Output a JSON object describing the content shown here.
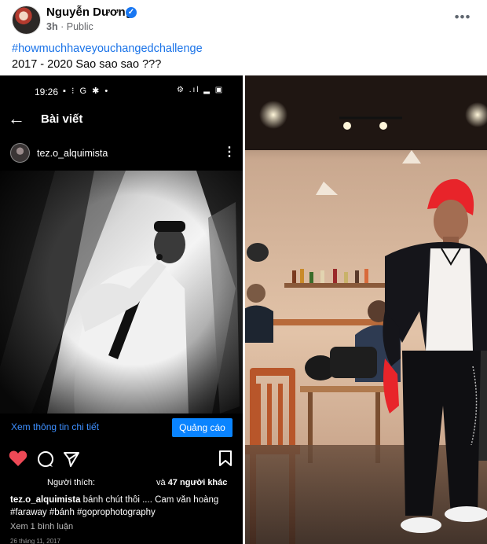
{
  "post": {
    "author": "Nguyễn Dương",
    "time": "3h",
    "separator": "·",
    "audience": "Public",
    "more_glyph": "•••",
    "hashtag": "#howmuchhaveyouchangedchallenge",
    "caption": "2017 - 2020 Sao sao sao ???"
  },
  "icons": {
    "verified": "verified-badge-icon",
    "more": "more-options-icon"
  },
  "instagram": {
    "status_time": "19:26",
    "status_icons": "▪ ⁝ G ✱ •",
    "status_right": "⚙ .ıl ▂ ▣",
    "title": "Bài viết",
    "username": "tez.o_alquimista",
    "details_link": "Xem thông tin chi tiết",
    "ad_button": "Quảng cáo",
    "likes_label": "Người thích:",
    "likes_prefix": "và ",
    "likes_count": "47 người khác",
    "caption_user": "tez.o_alquimista",
    "caption_text": " bánh chút thôi .... Cam văn hoàng",
    "caption_tags": "#faraway #bánh #goprophotography",
    "comments": "Xem 1 bình luận",
    "date": "26 tháng 11, 2017"
  },
  "colors": {
    "link_blue": "#1a73e8",
    "verified_blue": "#1877f2",
    "ig_button_blue": "#0a84ff",
    "heart_red": "#ed4956",
    "hair_red": "#e8242a"
  }
}
